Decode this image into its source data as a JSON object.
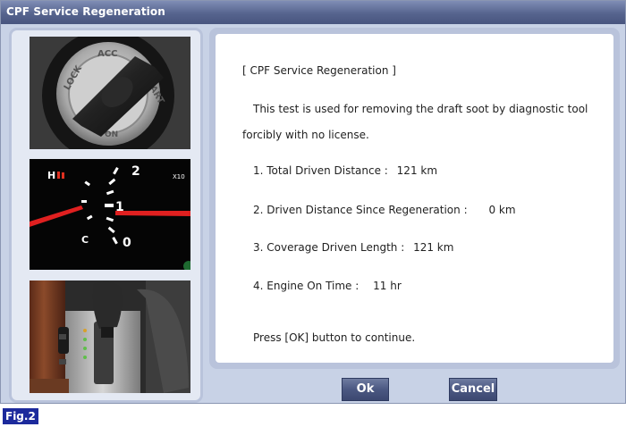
{
  "window": {
    "title": "CPF Service Regeneration"
  },
  "message": {
    "heading": "[ CPF Service Regeneration ]",
    "description_line1": "This test is used for removing the draft soot by diagnostic tool",
    "description_line2": "forcibly with no license.",
    "items": [
      {
        "label": "1. Total Driven Distance :",
        "value": "121 km"
      },
      {
        "label": "2. Driven Distance Since Regeneration :",
        "value": "0 km"
      },
      {
        "label": "3. Coverage Driven Length :",
        "value": "121 km"
      },
      {
        "label": "4. Engine On Time :",
        "value": "11 hr"
      }
    ],
    "prompt": "Press [OK] button to continue."
  },
  "buttons": {
    "ok_label": "Ok",
    "cancel_label": "Cancel"
  },
  "images": {
    "ignition_text": [
      "LOCK",
      "ACC",
      "START",
      "ON"
    ],
    "gauge_text": [
      "H",
      "C",
      "2",
      "1",
      "0",
      "X10"
    ]
  },
  "figure_label": "Fig.2",
  "colors": {
    "titlebar": "#56648e",
    "panel_border": "#b9c3db",
    "window_bg": "#c8d2e6",
    "button": "#4b5882",
    "figure_label_bg": "#1c2a9c",
    "gauge_needle": "#e02020"
  }
}
